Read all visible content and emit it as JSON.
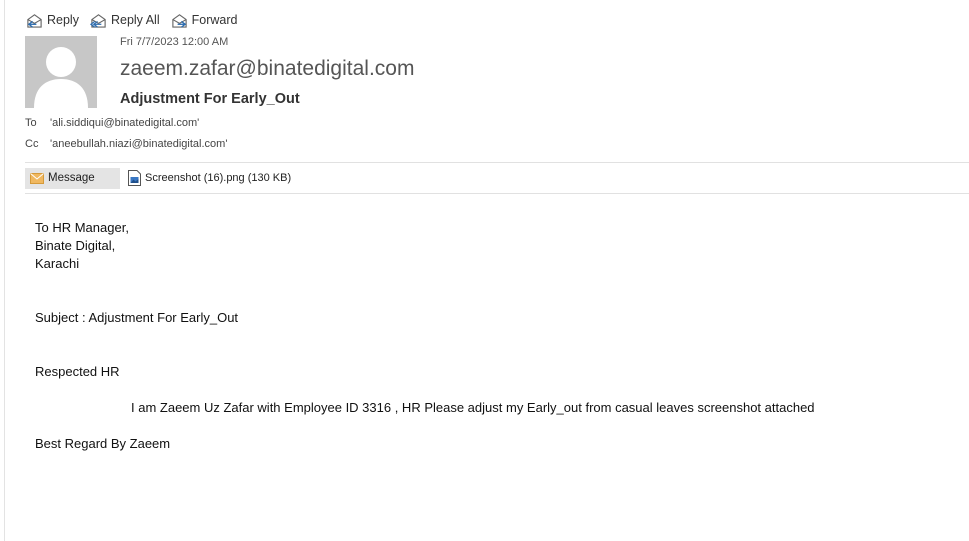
{
  "toolbar": {
    "reply_label": "Reply",
    "reply_all_label": "Reply All",
    "forward_label": "Forward"
  },
  "header": {
    "date": "Fri 7/7/2023 12:00 AM",
    "sender": "zaeem.zafar@binatedigital.com",
    "subject": "Adjustment For Early_Out",
    "to_label": "To",
    "to_value": "'ali.siddiqui@binatedigital.com'",
    "cc_label": "Cc",
    "cc_value": "'aneebullah.niazi@binatedigital.com'"
  },
  "attachments": {
    "message_tab_label": "Message",
    "files": [
      {
        "name": "Screenshot (16).png (130 KB)"
      }
    ]
  },
  "body": {
    "addressee_line1": "To HR Manager,",
    "addressee_line2": "Binate Digital,",
    "addressee_line3": "Karachi",
    "subject_line": "Subject :  Adjustment For Early_Out",
    "greeting": "Respected HR",
    "paragraph": "I am Zaeem Uz Zafar with Employee ID 3316 , HR Please adjust my Early_out from  casual leaves  screenshot attached",
    "closing": "Best Regard By Zaeem"
  }
}
